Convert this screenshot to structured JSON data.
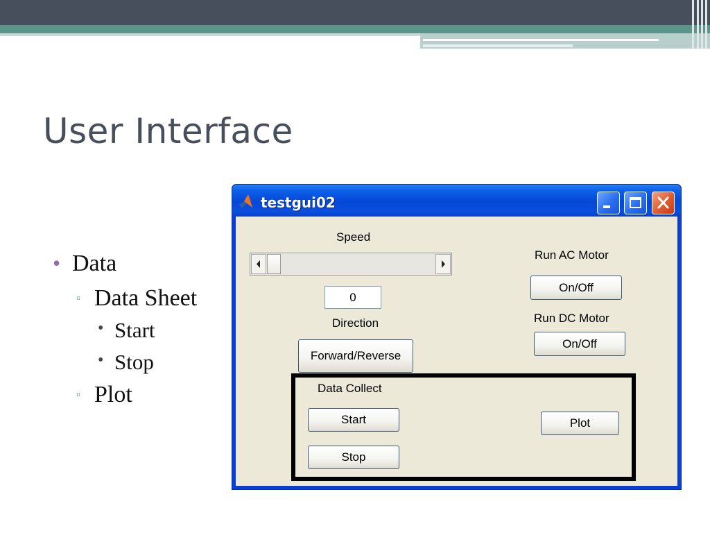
{
  "slide": {
    "title": "User Interface",
    "bullets": [
      {
        "level": 1,
        "text": "Data"
      },
      {
        "level": 2,
        "text": "Data Sheet"
      },
      {
        "level": 3,
        "text": "Start"
      },
      {
        "level": 3,
        "text": "Stop"
      },
      {
        "level": 2,
        "text": "Plot"
      }
    ],
    "markers": {
      "level1": "•",
      "level2": "▫",
      "level3": "•"
    },
    "colors": {
      "title": "#474e5c",
      "bullet_level1": "#8f6bb0",
      "bullet_level2": "#5c948c"
    }
  },
  "window": {
    "title": "testgui02",
    "title_icon": "matlab-icon",
    "controls": [
      "minimize-icon",
      "maximize-icon",
      "close-icon"
    ],
    "speed_label": "Speed",
    "speed_value": "0",
    "direction_label": "Direction",
    "direction_button": "Forward/Reverse",
    "ac_label": "Run AC Motor",
    "ac_button": "On/Off",
    "dc_label": "Run DC Motor",
    "dc_button": "On/Off",
    "panel_label": "Data Collect",
    "start_button": "Start",
    "stop_button": "Stop",
    "plot_button": "Plot",
    "colors": {
      "titlebar": "#0648d6",
      "client": "#ece9d8",
      "close_button": "#e15a2e"
    }
  }
}
